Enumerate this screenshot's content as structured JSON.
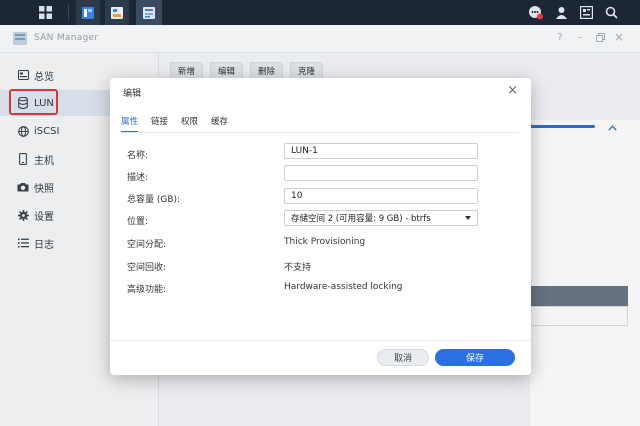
{
  "app": {
    "title": "SAN Manager"
  },
  "colors": {
    "accent": "#2b70e0",
    "highlight": "#e3393c",
    "taskbar": "#1c2634"
  },
  "sidebar": {
    "items": [
      {
        "label": "总览",
        "icon": "overview-icon"
      },
      {
        "label": "LUN",
        "icon": "database-icon"
      },
      {
        "label": "iSCSI",
        "icon": "globe-icon"
      },
      {
        "label": "主机",
        "icon": "phone-icon"
      },
      {
        "label": "快照",
        "icon": "camera-icon"
      },
      {
        "label": "设置",
        "icon": "gear-icon"
      },
      {
        "label": "日志",
        "icon": "list-icon"
      }
    ],
    "active": "LUN"
  },
  "toolbar": {
    "new_label": "新增",
    "edit_label": "编辑",
    "delete_label": "删除",
    "clone_label": "克隆"
  },
  "dialog": {
    "title": "编辑",
    "tabs": [
      {
        "label": "属性"
      },
      {
        "label": "链接"
      },
      {
        "label": "权限"
      },
      {
        "label": "缓存"
      }
    ],
    "fields": {
      "name_label": "名称:",
      "name_value": "LUN-1",
      "desc_label": "描述:",
      "desc_value": "",
      "capacity_label": "总容量 (GB):",
      "capacity_value": "10",
      "location_label": "位置:",
      "location_value": "存储空间 2 (可用容量: 9 GB) - btrfs",
      "allocation_label": "空间分配:",
      "allocation_value": "Thick Provisioning",
      "reclaim_label": "空间回收:",
      "reclaim_value": "不支持",
      "advanced_label": "高级功能:",
      "advanced_value": "Hardware-assisted locking"
    },
    "cancel_label": "取消",
    "save_label": "保存"
  }
}
